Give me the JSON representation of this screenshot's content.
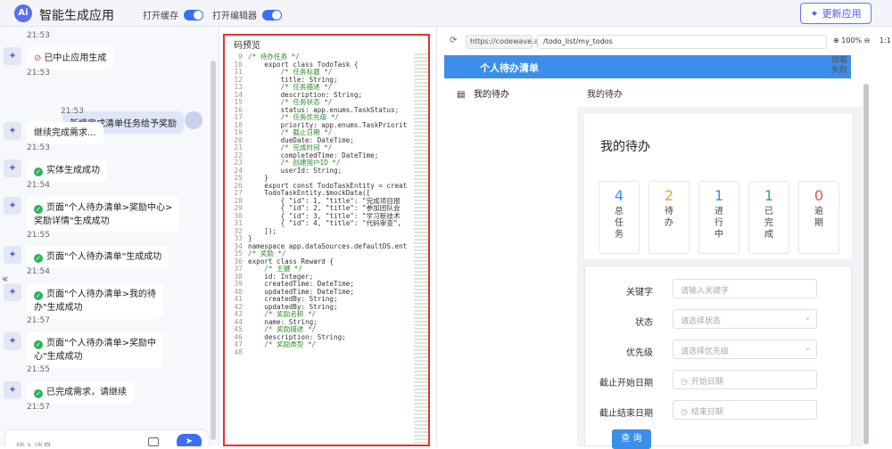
{
  "topbar": {
    "logo_text": "Ai",
    "title": "智能生成应用",
    "toggle_cache": "打开缓存",
    "toggle_editor": "打开编辑器",
    "update_button": "更新应用"
  },
  "chat": {
    "messages": [
      {
        "time": "21:53"
      },
      {
        "text": "已中止应用生成",
        "time": "21:53"
      },
      {
        "user_text": "新增完成清单任务给予奖励",
        "time": "21:53"
      },
      {
        "text": "继续完成需求...",
        "time": "21:53"
      },
      {
        "text": "实体生成成功",
        "time": "21:54"
      },
      {
        "line1": "页面\"个人待办清单>奖励中心>",
        "line2": "奖励详情\"生成成功",
        "time": "21:55"
      },
      {
        "text": "页面\"个人待办清单\"生成成功",
        "time": "21:54"
      },
      {
        "line1": "页面\"个人待办清单>我的待",
        "line2": "办\"生成成功",
        "time": "21:57"
      },
      {
        "line1": "页面\"个人待办清单>奖励中",
        "line2": "心\"生成成功",
        "time": "21:55"
      },
      {
        "text": "已完成需求，请继续",
        "time": "21:57"
      }
    ],
    "input_placeholder": "输入消息"
  },
  "code": {
    "tab_label": "码预览",
    "line_numbers": [
      "9",
      "10",
      "11",
      "12",
      "13",
      "14",
      "15",
      "16",
      "17",
      "18",
      "19",
      "20",
      "21",
      "22",
      "23",
      "24",
      "25",
      "26",
      "27",
      "28",
      "29",
      "30",
      "31",
      "32",
      "33",
      "34",
      "35",
      "36",
      "37",
      "38",
      "39",
      "40",
      "41",
      "42",
      "43",
      "44",
      "45",
      "46",
      "47",
      "48"
    ],
    "lines": [
      "/* 待办任务 */",
      "    export class TodoTask {",
      "        /* 任务标题 */",
      "        title: String;",
      "        /* 任务描述 */",
      "        description: String;",
      "        /* 任务状态 */",
      "        status: app.enums.TaskStatus;",
      "        /* 任务优先级 */",
      "        priority: app.enums.TaskPriorit",
      "        /* 截止日期 */",
      "        dueDate: DateTime;",
      "        /* 完成时间 */",
      "        completedTime: DateTime;",
      "        /* 创建用户ID */",
      "        userId: String;",
      "    }",
      "    export const TodoTaskEntity = creat",
      "    TodoTaskEntity.$mockData([",
      "        { \"id\": 1, \"title\": \"完成项目报",
      "        { \"id\": 2, \"title\": \"参加团队会",
      "        { \"id\": 3, \"title\": \"学习新技术",
      "        { \"id\": 4, \"title\": \"代码审查\",",
      "    ]);",
      "",
      "}",
      "namespace app.dataSources.defaultDS.ent",
      "/* 奖励 */",
      "export class Reward {",
      "    /* 主键 */",
      "    id: Integer;",
      "    createdTime: DateTime;",
      "    updatedTime: DateTime;",
      "    createdBy: String;",
      "    updatedBy: String;",
      "    /* 奖励名称 */",
      "    name: String;",
      "    /* 奖励描述 */",
      "    description: String;",
      "    /* 奖励类型 */"
    ]
  },
  "preview": {
    "url_base": "https://codewave.ai",
    "url_path": "/todo_list/my_todos",
    "zoom": "100%",
    "ratio": "1:1",
    "header_title": "个人待办清单",
    "load_fail_1": "加载",
    "load_fail_2": "失败",
    "nav_item": "我的待办",
    "breadcrumb": "我的待办",
    "card_title": "我的待办",
    "stats": [
      {
        "value": "4",
        "label": "总任务",
        "color": "#3b8eea"
      },
      {
        "value": "2",
        "label": "待办",
        "color": "#f0a030"
      },
      {
        "value": "1",
        "label": "进行中",
        "color": "#3b8eea"
      },
      {
        "value": "1",
        "label": "已完成",
        "color": "#2db35a"
      },
      {
        "value": "0",
        "label": "逾期",
        "color": "#f05050"
      }
    ],
    "form": {
      "keyword_label": "关键字",
      "keyword_placeholder": "请输入关键字",
      "status_label": "状态",
      "status_placeholder": "请选择状态",
      "priority_label": "优先级",
      "priority_placeholder": "请选择优先级",
      "start_label": "截止开始日期",
      "start_placeholder": "开始日期",
      "end_label": "截止结束日期",
      "end_placeholder": "结束日期",
      "query_button": "查 询"
    }
  }
}
